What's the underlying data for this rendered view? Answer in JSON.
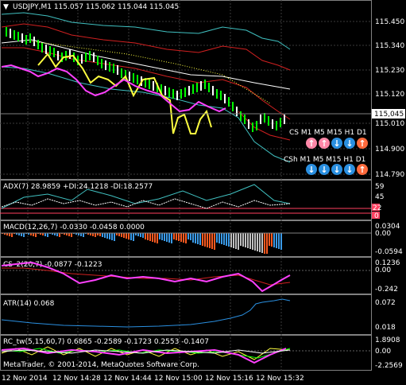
{
  "main": {
    "symbol_header": "USDJPY,M1  115.057 115.062 115.044 115.045",
    "price_ticks": [
      "115.450",
      "115.340",
      "115.230",
      "115.120",
      "115.010",
      "114.900",
      "114.790"
    ],
    "current_price": "115,045",
    "cs_label": "CS M1 M5 M15 H1 D1",
    "csh_label": "CSh M1 M5 M15 H1 D1",
    "cs_arrows": [
      "up",
      "up",
      "down",
      "down",
      "up"
    ],
    "csh_arrows": [
      "down",
      "down",
      "down",
      "down",
      "up"
    ],
    "colors": {
      "arrow_up": "#ff88a8",
      "arrow_down": "#2a8fe0",
      "arrow_up_last": "#ff6a3c",
      "bull_candle": "#00ff00",
      "bear_candle": "#ffffff"
    }
  },
  "adx": {
    "title": "ADX(7) 28.9859 +DI:24.1218 -DI:18.2577",
    "ticks": [
      "59",
      "45",
      "22",
      "0"
    ]
  },
  "macd": {
    "title": "MACD(12,26,7) -0.0330 -0.0458 0.0000",
    "ticks": [
      "0.0304",
      "0.00",
      "-0.0594"
    ]
  },
  "cs2": {
    "title": "CS_2(20,7) -0.0877 -0.1223",
    "ticks": [
      "0.1236",
      "0.00",
      "-0.242"
    ]
  },
  "atr": {
    "title": "ATR(14) 0.068",
    "ticks": [
      "0.072",
      "0.018"
    ]
  },
  "rc": {
    "title": "RC_tw(5,15,60,7) 0.6865 -0.2589 -0.1723 0.2553 -0.1407",
    "ticks": [
      "1.8908",
      "0.00",
      "-2.2569"
    ],
    "copyright": "MetaTrader, © 2001-2014, MetaQuotes Software Corp."
  },
  "time_axis": [
    "12 Nov 2014",
    "12 Nov 14:28",
    "12 Nov 14:44",
    "12 Nov 15:00",
    "12 Nov 15:16",
    "12 Nov 15:32"
  ]
}
